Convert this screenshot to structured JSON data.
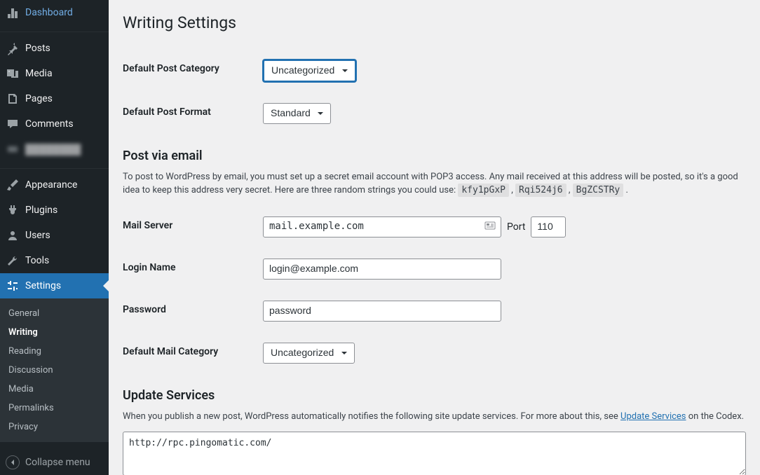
{
  "sidebar": {
    "items": [
      {
        "label": "Dashboard",
        "icon": "dashboard"
      },
      {
        "label": "Posts",
        "icon": "posts"
      },
      {
        "label": "Media",
        "icon": "media"
      },
      {
        "label": "Pages",
        "icon": "pages"
      },
      {
        "label": "Comments",
        "icon": "comments"
      },
      {
        "label": "████████",
        "icon": "blur"
      },
      {
        "label": "Appearance",
        "icon": "appearance"
      },
      {
        "label": "Plugins",
        "icon": "plugins"
      },
      {
        "label": "Users",
        "icon": "users"
      },
      {
        "label": "Tools",
        "icon": "tools"
      },
      {
        "label": "Settings",
        "icon": "settings"
      }
    ],
    "submenu": [
      "General",
      "Writing",
      "Reading",
      "Discussion",
      "Media",
      "Permalinks",
      "Privacy"
    ],
    "submenu_active": "Writing",
    "collapse": "Collapse menu"
  },
  "page": {
    "title": "Writing Settings",
    "default_post_category_label": "Default Post Category",
    "default_post_category_value": "Uncategorized",
    "default_post_format_label": "Default Post Format",
    "default_post_format_value": "Standard",
    "post_via_email_heading": "Post via email",
    "post_via_email_intro": "To post to WordPress by email, you must set up a secret email account with POP3 access. Any mail received at this address will be posted, so it's a good idea to keep this address very secret. Here are three random strings you could use: ",
    "random1": "kfy1pGxP",
    "random2": "Rqi524j6",
    "random3": "BgZCSTRy",
    "mail_server_label": "Mail Server",
    "mail_server_value": "mail.example.com",
    "port_label": "Port",
    "port_value": "110",
    "login_name_label": "Login Name",
    "login_name_value": "login@example.com",
    "password_label": "Password",
    "password_value": "password",
    "default_mail_category_label": "Default Mail Category",
    "default_mail_category_value": "Uncategorized",
    "update_services_heading": "Update Services",
    "update_services_intro_1": "When you publish a new post, WordPress automatically notifies the following site update services. For more about this, see ",
    "update_services_link": "Update Services",
    "update_services_intro_2": " on the Codex.",
    "ping_value": "http://rpc.pingomatic.com/"
  }
}
